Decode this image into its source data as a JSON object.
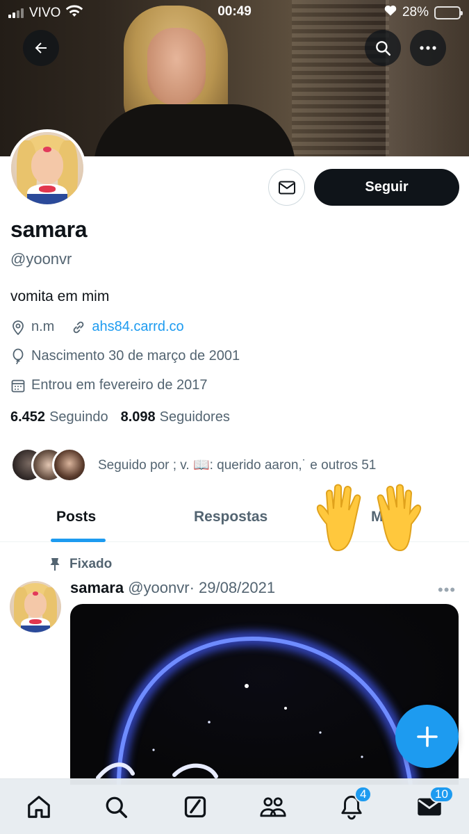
{
  "status_bar": {
    "carrier": "VIVO",
    "time": "00:49",
    "battery_percent": "28%",
    "battery_level": 0.28,
    "battery_color": "#ffcc00"
  },
  "header": {
    "back_icon": "arrow-left-icon",
    "search_icon": "search-icon",
    "more_icon": "more-horizontal-icon"
  },
  "profile": {
    "display_name": "samara",
    "handle": "@yoonvr",
    "bio": "vomita em mim",
    "location": "n.m",
    "website": "ahs84.carrd.co",
    "birthday": "Nascimento 30 de março de 2001",
    "joined": "Entrou em fevereiro de 2017",
    "following_count": "6.452",
    "following_label": "Seguindo",
    "followers_count": "8.098",
    "followers_label": "Seguidores",
    "followed_by": "Seguido por ; v. 📖: querido aaron,˙ e outros 51",
    "follow_button": "Seguir"
  },
  "tabs": [
    {
      "label": "Posts",
      "active": true
    },
    {
      "label": "Respostas",
      "active": false
    },
    {
      "label": "Mí",
      "active": false
    }
  ],
  "sticker": "🙌",
  "pinned_post": {
    "pinned_label": "Fixado",
    "author_name": "samara",
    "author_handle": "@yoonvr",
    "separator": "·",
    "date": "29/08/2021",
    "more": "•••"
  },
  "bottom_nav": [
    {
      "icon": "home-icon",
      "badge": ""
    },
    {
      "icon": "search-icon",
      "badge": ""
    },
    {
      "icon": "grok-icon",
      "badge": ""
    },
    {
      "icon": "communities-icon",
      "badge": ""
    },
    {
      "icon": "bell-icon",
      "badge": "4"
    },
    {
      "icon": "mail-icon",
      "badge": "10"
    }
  ],
  "colors": {
    "accent": "#1d9bf0",
    "text": "#0f1419",
    "secondary_text": "#536471",
    "follow_button_bg": "#0f1419"
  }
}
